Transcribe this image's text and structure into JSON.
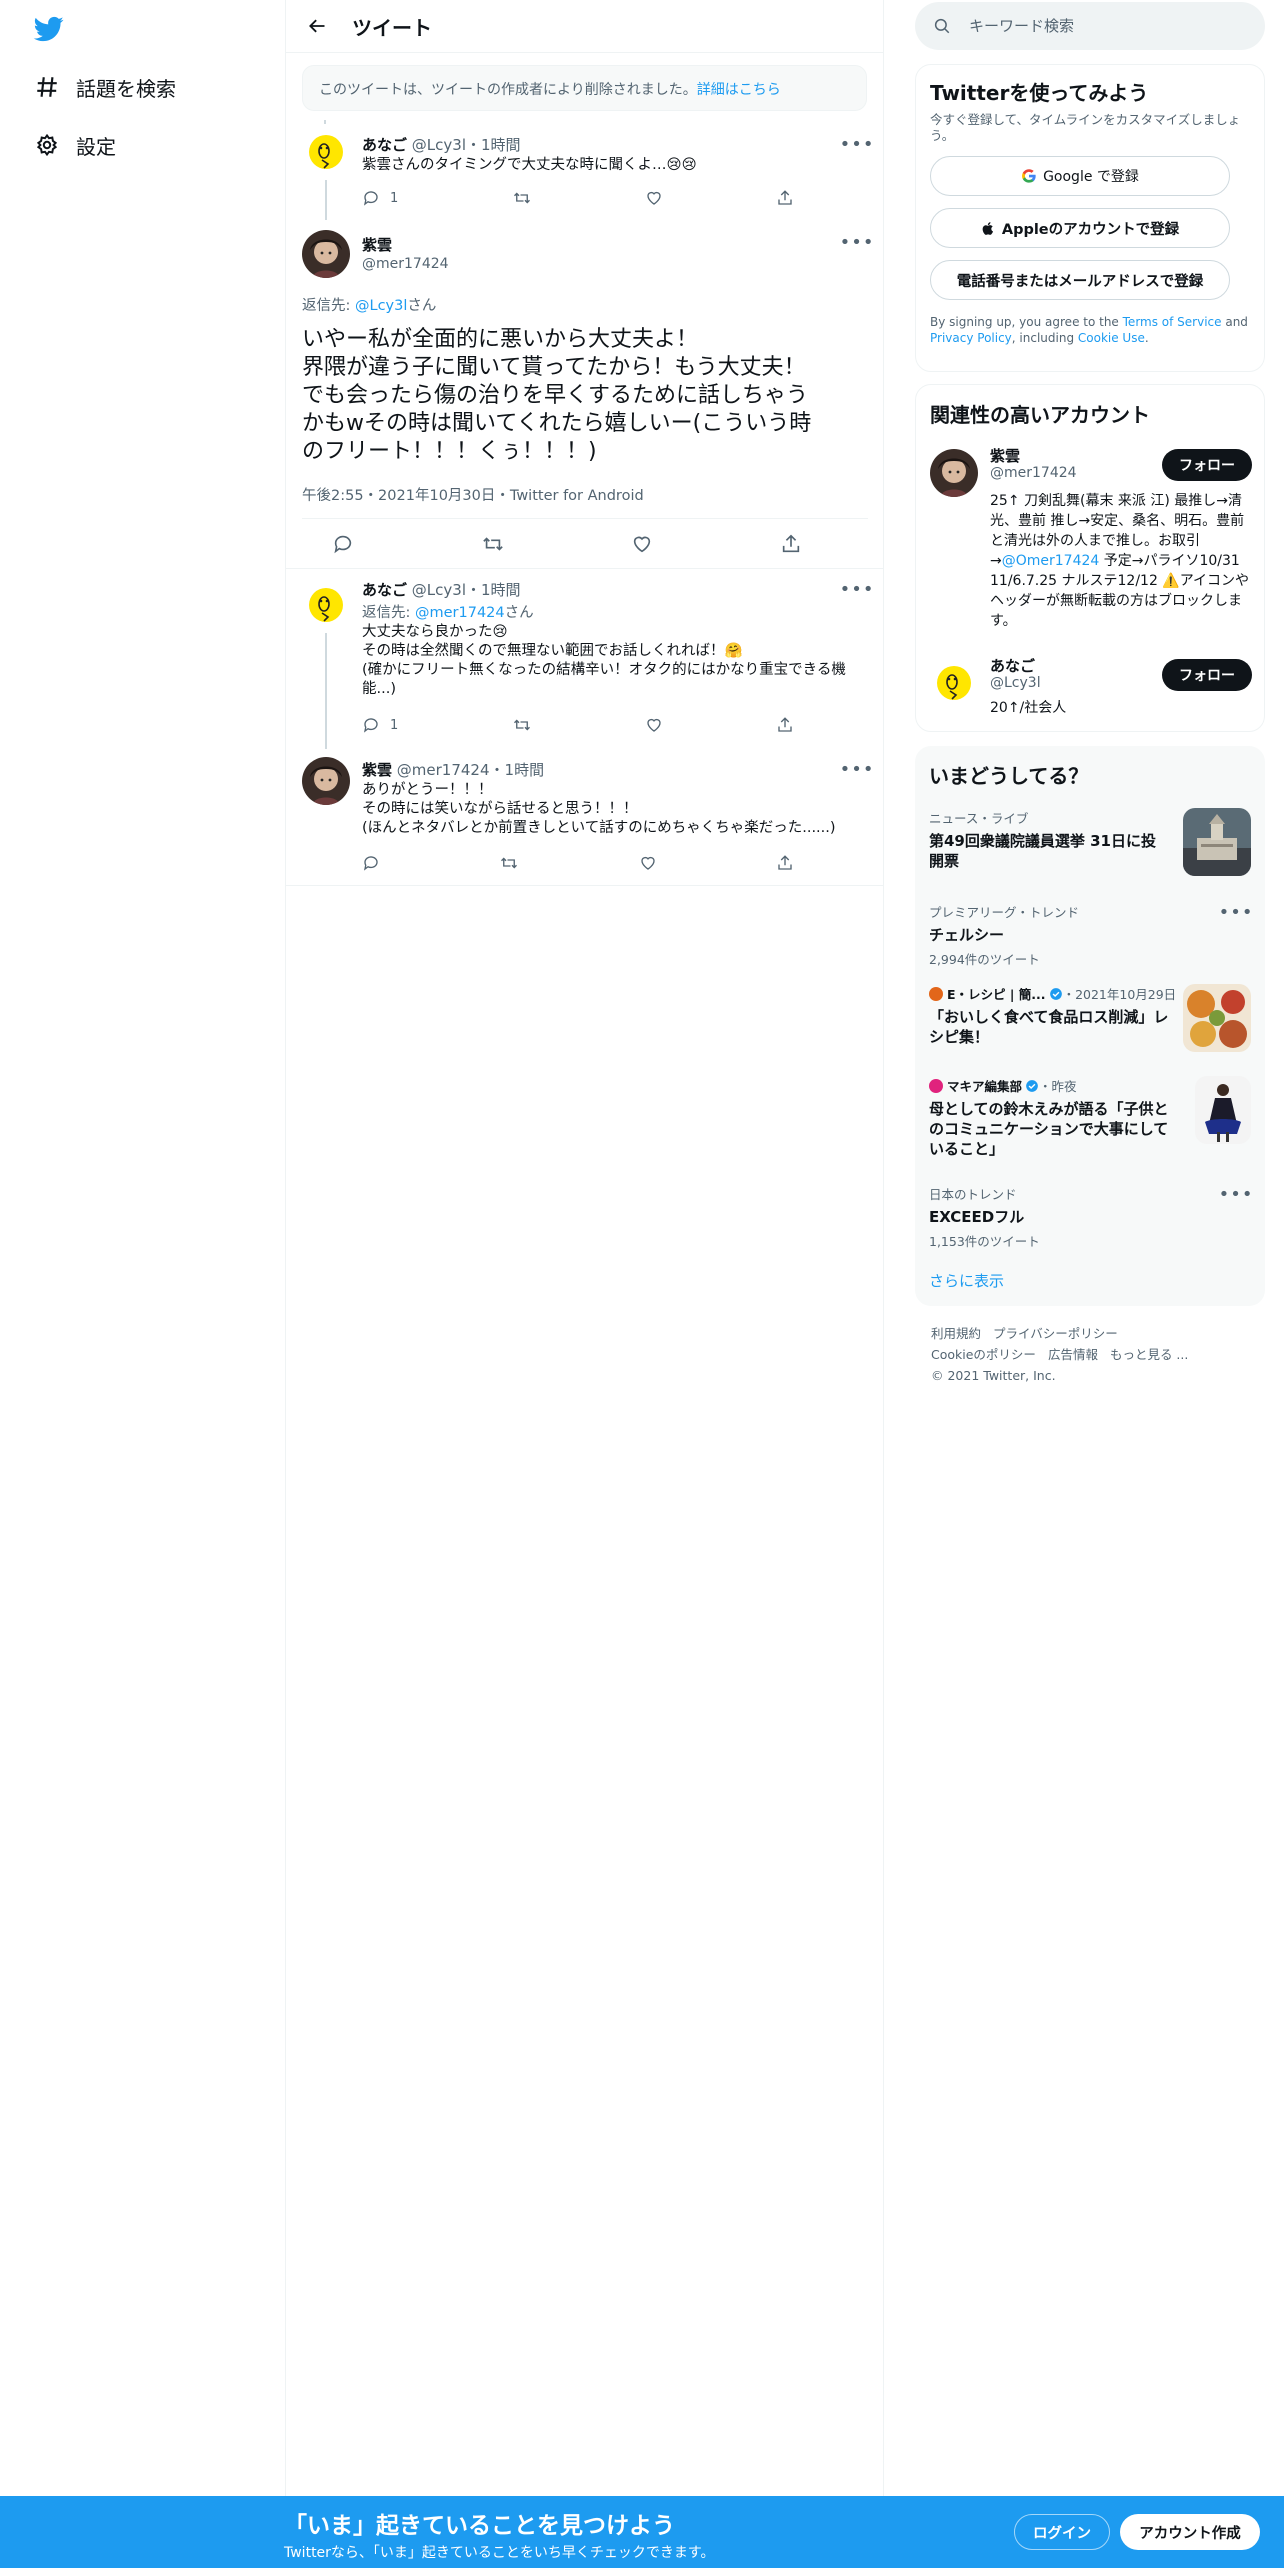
{
  "nav": {
    "logo": "twitter-bird-logo",
    "items": [
      {
        "label": "話題を検索",
        "icon": "hashtag-icon"
      },
      {
        "label": "設定",
        "icon": "gear-icon"
      }
    ]
  },
  "header": {
    "title": "ツイート"
  },
  "deleted_notice": {
    "text": "このツイートは、ツイートの作成者により削除されました。",
    "link": "詳細はこちら"
  },
  "tweets": [
    {
      "name": "あなご",
      "handle": "@Lcy3l",
      "time": "1時間",
      "text": "紫雲さんのタイミングで大丈夫な時に聞くよ…😢😢",
      "reply_count": "1"
    },
    {
      "name": "紫雲",
      "handle": "@mer17424",
      "reply_prefix": "返信先: ",
      "reply_to": "@Lcy3l",
      "reply_suffix": "さん",
      "lines": [
        "いやー私が全面的に悪いから大丈夫よ！",
        "界隈が違う子に聞いて貰ってたから！もう大丈夫！",
        "でも会ったら傷の治りを早くするために話しちゃう",
        "かもwその時は聞いてくれたら嬉しいー(こういう時",
        "のフリート！！！くぅ！！！)"
      ],
      "timestamp": "午後2:55・2021年10月30日・Twitter for Android"
    },
    {
      "name": "あなご",
      "handle": "@Lcy3l",
      "time": "1時間",
      "reply_prefix": "返信先: ",
      "reply_to": "@mer17424",
      "reply_suffix": "さん",
      "lines": [
        "大丈夫なら良かった😢",
        "その時は全然聞くので無理ない範囲でお話しくれれば！🤗",
        "(確かにフリート無くなったの結構辛い！オタク的にはかなり重宝できる機",
        "能...)"
      ],
      "reply_count": "1"
    },
    {
      "name": "紫雲",
      "handle": "@mer17424",
      "time": "1時間",
      "lines": [
        "ありがとうー！！！",
        "その時には笑いながら話せると思う！！！",
        "(ほんとネタバレとか前置きしといて話すのにめちゃくちゃ楽だった......)"
      ]
    }
  ],
  "search": {
    "placeholder": "キーワード検索"
  },
  "signup": {
    "title": "Twitterを使ってみよう",
    "subtitle": "今すぐ登録して、タイムラインをカスタマイズしましょう。",
    "google": "Google で登録",
    "apple": "Appleのアカウントで登録",
    "phone": "電話番号またはメールアドレスで登録",
    "terms_prefix": "By signing up, you agree to the ",
    "terms_link": "Terms of Service",
    "terms_and": " and ",
    "privacy_link": "Privacy Policy",
    "terms_including": ", including ",
    "cookie_link": "Cookie Use",
    "terms_end": "."
  },
  "relevant": {
    "title": "関連性の高いアカウント",
    "accounts": [
      {
        "name": "紫雲",
        "handle": "@mer17424",
        "follow": "フォロー",
        "bio_a": "25↑ 刀剣乱舞(幕末 来派 江) 最推し→清光、豊前 推し→安定、桑名、明石。豊前と清光は外の人まで推し。お取引→",
        "bio_link": "@Omer17424",
        "bio_b": " 予定→パライソ10/31 11/6.7.25 ナルステ12/12 ⚠️アイコンやヘッダーが無断転載の方はブロックします。"
      },
      {
        "name": "あなご",
        "handle": "@Lcy3l",
        "follow": "フォロー",
        "bio": "20↑/社会人"
      }
    ]
  },
  "trends": {
    "title": "いまどうしてる？",
    "items": [
      {
        "meta": "ニュース・ライブ",
        "title": "第49回衆議院議員選挙 31日に投開票"
      },
      {
        "meta": "プレミアリーグ・トレンド",
        "title": "チェルシー",
        "count": "2,994件のツイート"
      },
      {
        "meta_name": "E・レシピ | 簡...",
        "meta_date": "・2021年10月29日",
        "title": "「おいしく食べて食品ロス削減」レシピ集！"
      },
      {
        "meta_name": "マキア編集部",
        "meta_date": "・昨夜",
        "title": "母としての鈴木えみが語る「子供とのコミュニケーションで大事にしていること」"
      },
      {
        "meta": "日本のトレンド",
        "title": "EXCEEDフル",
        "count": "1,153件のツイート"
      }
    ],
    "show_more": "さらに表示"
  },
  "footer": {
    "links": [
      "利用規約",
      "プライバシーポリシー",
      "Cookieのポリシー",
      "広告情報",
      "もっと見る ..."
    ],
    "copyright": "© 2021 Twitter, Inc."
  },
  "bottom_bar": {
    "title": "「いま」起きていることを見つけよう",
    "subtitle": "Twitterなら、「いま」起きていることをいち早くチェックできます。",
    "login": "ログイン",
    "signup": "アカウント作成"
  },
  "colors": {
    "accent": "#1d9bf0",
    "text": "#0f1419",
    "secondary": "#536471",
    "border": "#eff3f4"
  }
}
